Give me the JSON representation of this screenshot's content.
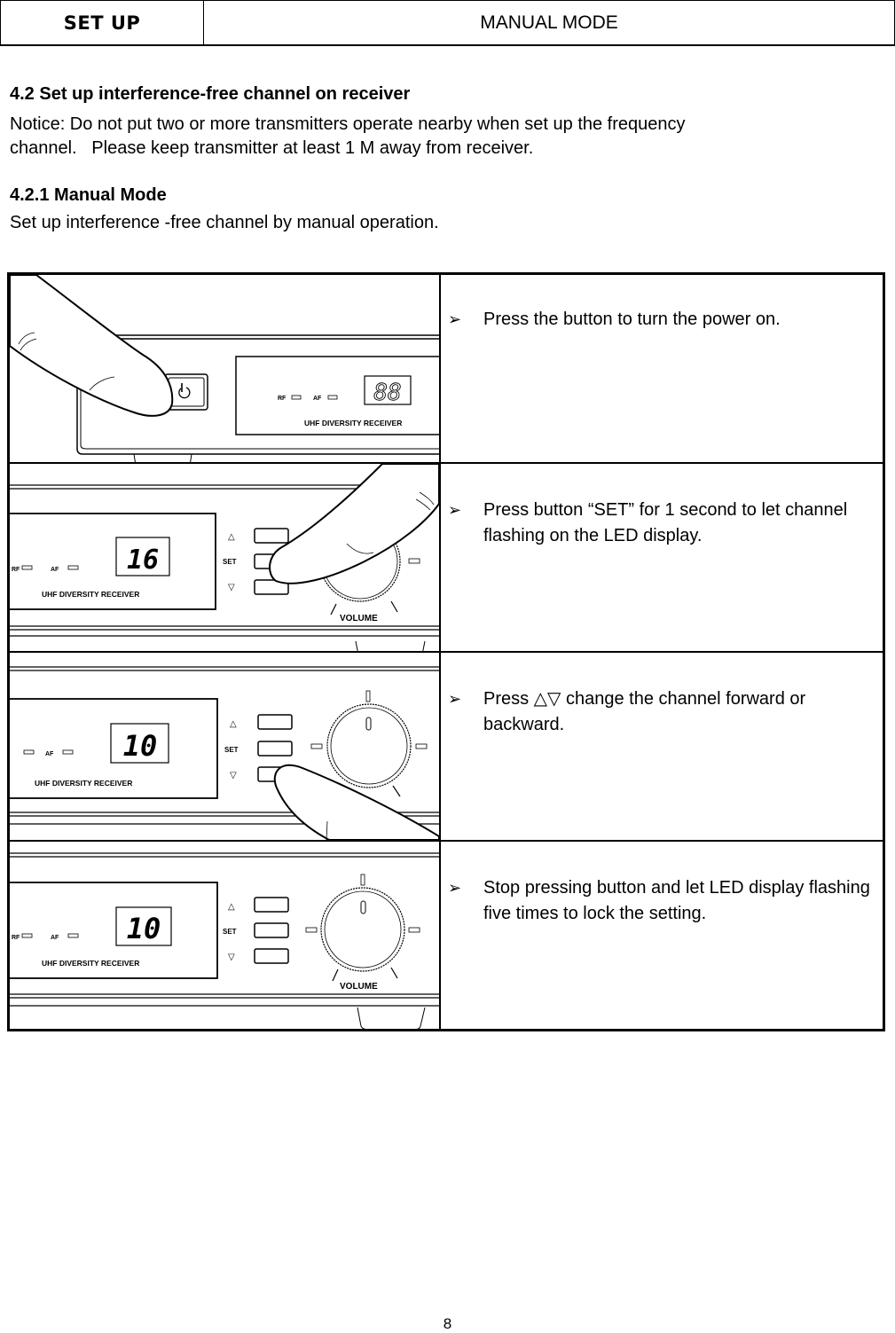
{
  "header": {
    "section": "SET UP",
    "title": "MANUAL MODE"
  },
  "section": {
    "heading": "4.2 Set up interference-free channel on receiver",
    "notice_line1": "Notice: Do not put two or more transmitters operate nearby when set up the frequency",
    "notice_line2": "channel.   Please keep transmitter at least 1 M away from receiver.",
    "subheading": "4.2.1 Manual Mode",
    "intro": "Set up interference -free channel by manual operation."
  },
  "device": {
    "rf_label": "RF",
    "af_label": "AF",
    "model_label": "UHF DIVERSITY RECEIVER",
    "set_label": "SET",
    "volume_label": "VOLUME",
    "up_symbol": "△",
    "down_symbol": "▽"
  },
  "steps": [
    {
      "bullet": "➢",
      "text": "Press the button to turn the power on.",
      "display": "88"
    },
    {
      "bullet": "➢",
      "text": "Press button “SET” for 1 second to let channel flashing on the LED display.",
      "display": "16"
    },
    {
      "bullet": "➢",
      "text": "Press △▽ change the channel forward or backward.",
      "display": "10"
    },
    {
      "bullet": "➢",
      "text": "Stop pressing button and let LED display flashing five times to lock the setting.",
      "display": "10"
    }
  ],
  "footer": {
    "page_number": "8"
  }
}
